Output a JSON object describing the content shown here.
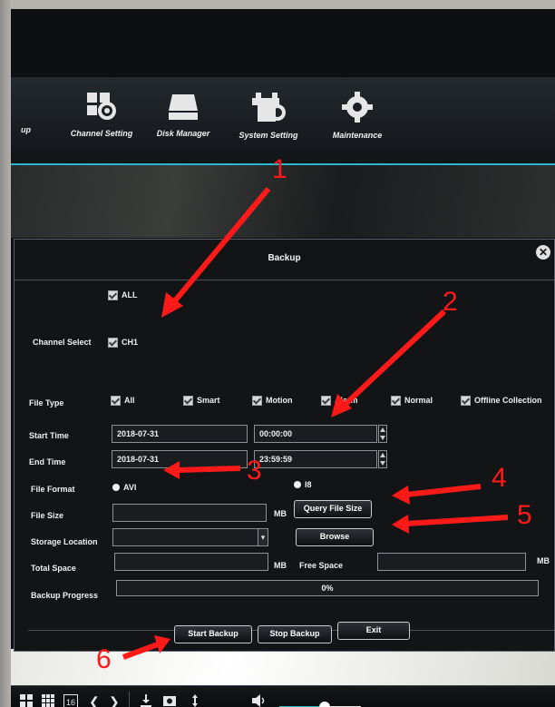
{
  "menu": {
    "items": [
      {
        "label": "up",
        "icon": "partial-backup-icon"
      },
      {
        "label": "Channel Setting",
        "icon": "channel-setting-icon"
      },
      {
        "label": "Disk Manager",
        "icon": "disk-manager-icon"
      },
      {
        "label": "System Setting",
        "icon": "system-setting-icon"
      },
      {
        "label": "Maintenance",
        "icon": "maintenance-gear-icon"
      }
    ]
  },
  "dialog": {
    "title": "Backup",
    "close_glyph": "✕",
    "channel": {
      "all_label": "ALL",
      "label": "Channel Select",
      "ch1_label": "CH1"
    },
    "file_type": {
      "label": "File Type",
      "options": [
        "All",
        "Smart",
        "Motion",
        "Alarm",
        "Normal",
        "Offline Collection"
      ]
    },
    "start_time": {
      "label": "Start Time",
      "date": "2018-07-31",
      "time": "00:00:00"
    },
    "end_time": {
      "label": "End Time",
      "date": "2018-07-31",
      "time": "23:59:59"
    },
    "file_format": {
      "label": "File Format",
      "option1": "AVI",
      "option2": "I8"
    },
    "file_size": {
      "label": "File Size",
      "value": "",
      "unit": "MB",
      "query_button": "Query File Size"
    },
    "storage": {
      "label": "Storage Location",
      "value": "",
      "browse_button": "Browse"
    },
    "space": {
      "total_label": "Total Space",
      "total_value": "",
      "unit": "MB",
      "free_label": "Free Space",
      "free_value": "",
      "free_unit": "MB"
    },
    "progress": {
      "label": "Backup Progress",
      "value": 0,
      "text": "0%"
    },
    "buttons": {
      "start": "Start Backup",
      "stop": "Stop Backup",
      "exit": "Exit"
    }
  },
  "toolbar": {
    "layout16_label": "16",
    "prev_glyph": "❮",
    "next_glyph": "❯",
    "volume_level": 0.55
  },
  "annotations": {
    "color": "#ff1a1a",
    "numbers": [
      "1",
      "2",
      "3",
      "4",
      "5",
      "6"
    ]
  }
}
